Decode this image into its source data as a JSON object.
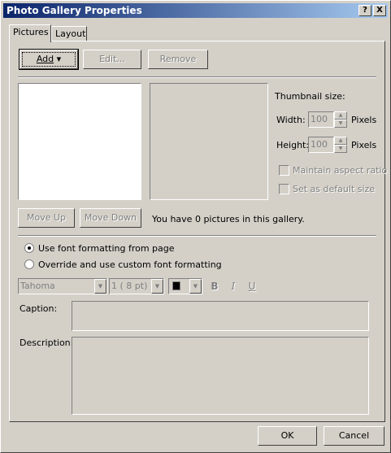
{
  "window": {
    "title": "Photo Gallery Properties",
    "help_label": "?",
    "close_label": "X"
  },
  "tabs": [
    {
      "label": "Pictures",
      "active": true
    },
    {
      "label": "Layout",
      "active": false
    }
  ],
  "toolbar": {
    "add_label": "Add",
    "add_arrow": "▾",
    "edit_label": "Edit...",
    "remove_label": "Remove"
  },
  "thumbnail": {
    "title": "Thumbnail size:",
    "width_label": "Width:",
    "width_value": "100",
    "width_unit": "Pixels",
    "height_label": "Height:",
    "height_value": "100",
    "height_unit": "Pixels",
    "maintain_aspect_label": "Maintain aspect ratio",
    "set_default_label": "Set as default size"
  },
  "list": {
    "move_up_label": "Move Up",
    "move_down_label": "Move Down",
    "status": "You have 0 pictures in this gallery."
  },
  "formatting": {
    "use_page_label": "Use font formatting from page",
    "override_label": "Override and use custom font formatting",
    "font_name": "Tahoma",
    "font_size": "1  ( 8 pt)",
    "bold": "B",
    "italic": "I",
    "underline": "U"
  },
  "fields": {
    "caption_label": "Caption:",
    "description_label": "Description:"
  },
  "footer": {
    "ok_label": "OK",
    "cancel_label": "Cancel"
  }
}
